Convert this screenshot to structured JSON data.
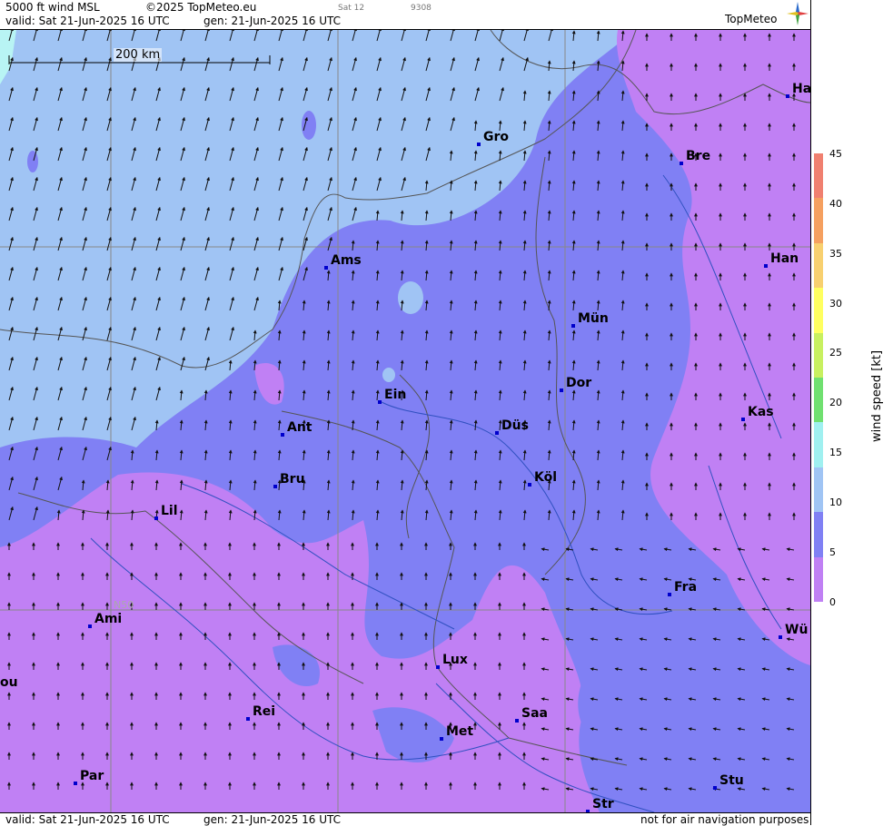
{
  "header": {
    "product": "5000 ft wind MSL",
    "copyright": "©2025 TopMeteo.eu",
    "run_small": "Sat 12",
    "code_small": "9308",
    "valid": "valid:  Sat  21-Jun-2025  16 UTC",
    "generated": "gen: 21-Jun-2025 16 UTC",
    "logo": "TopMeteo"
  },
  "footer": {
    "valid": "valid:  Sat  21-Jun-2025  16 UTC",
    "generated": "gen: 21-Jun-2025 16 UTC",
    "disclaimer": "not for air navigation purposes"
  },
  "map": {
    "scale_bar": "200 km",
    "grid_label": "N50",
    "cities": [
      {
        "label": "Ha"
      },
      {
        "label": "Gro"
      },
      {
        "label": "Bre"
      },
      {
        "label": "Ams"
      },
      {
        "label": "Han"
      },
      {
        "label": "Mün"
      },
      {
        "label": "Ein"
      },
      {
        "label": "Dor"
      },
      {
        "label": "Kas"
      },
      {
        "label": "Ant"
      },
      {
        "label": "Düs"
      },
      {
        "label": "Bru"
      },
      {
        "label": "Köl"
      },
      {
        "label": "Lil"
      },
      {
        "label": "Fra"
      },
      {
        "label": "Ami"
      },
      {
        "label": "Wü"
      },
      {
        "label": "Lux"
      },
      {
        "label": "ou"
      },
      {
        "label": "Rei"
      },
      {
        "label": "Saa"
      },
      {
        "label": "Met"
      },
      {
        "label": "Par"
      },
      {
        "label": "Stu"
      },
      {
        "label": "Str"
      }
    ]
  },
  "legend": {
    "title": "wind speed [kt]",
    "ticks": [
      "45",
      "40",
      "35",
      "30",
      "25",
      "20",
      "15",
      "10",
      "5",
      "0"
    ],
    "colors": [
      "#f08070",
      "#f5a060",
      "#f8d070",
      "#ffff60",
      "#c8f060",
      "#70e070",
      "#a0f0f0",
      "#a0c4f4",
      "#8080f4",
      "#c080f4"
    ]
  }
}
